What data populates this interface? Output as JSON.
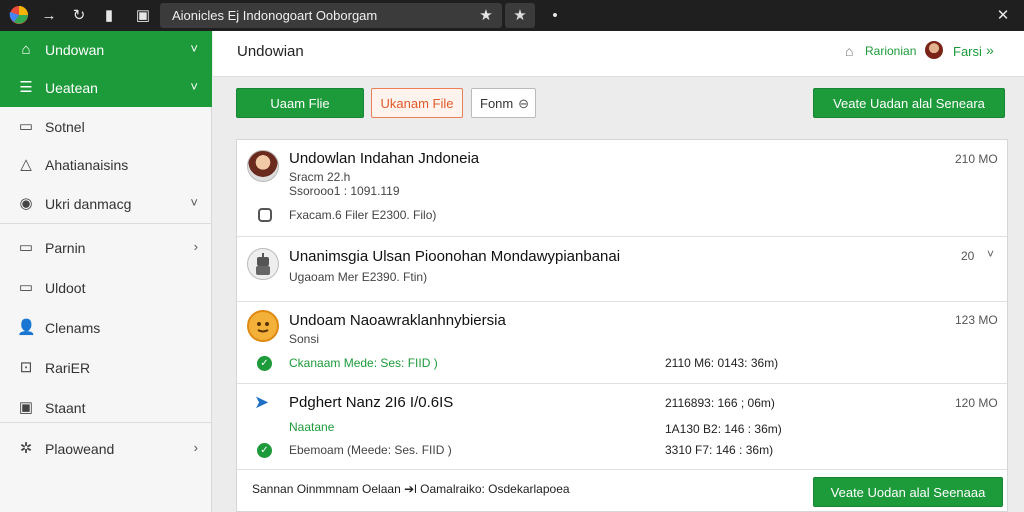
{
  "browser": {
    "url": "Aionicles Ej Indonogoart Ooborgam",
    "star": "★",
    "menu_dot": "•",
    "close": "✕"
  },
  "sidebar": {
    "items": [
      {
        "label": "Undowan",
        "icon": "home-icon",
        "glyph": "⌂",
        "chevron": "˅",
        "active": true
      },
      {
        "label": "Ueatean",
        "icon": "list-icon",
        "glyph": "☰",
        "chevron": "˅",
        "active": true
      },
      {
        "label": "Sotnel",
        "icon": "inbox-icon",
        "glyph": "▭",
        "chevron": ""
      },
      {
        "label": "Ahatianaisins",
        "icon": "bell-icon",
        "glyph": "△",
        "chevron": ""
      },
      {
        "label": "Ukri danmacg",
        "icon": "eye-icon",
        "glyph": "◉",
        "chevron": "˅"
      },
      {
        "label": "Parnin",
        "icon": "folder-icon",
        "glyph": "▭",
        "chevron": "›"
      },
      {
        "label": "Uldoot",
        "icon": "document-icon",
        "glyph": "▭",
        "chevron": ""
      },
      {
        "label": "Clenams",
        "icon": "user-icon",
        "glyph": "👤",
        "chevron": ""
      },
      {
        "label": "RariER",
        "icon": "tag-icon",
        "glyph": "⊡",
        "chevron": ""
      },
      {
        "label": "Staant",
        "icon": "image-icon",
        "glyph": "▣",
        "chevron": ""
      },
      {
        "label": "Plaoweand",
        "icon": "gear-icon",
        "glyph": "✲",
        "chevron": "›"
      }
    ]
  },
  "header": {
    "title": "Undowian",
    "link": "Rarionian",
    "user": "Farsi",
    "arrow": "»"
  },
  "toolbar": {
    "upload": "Uaam Flie",
    "upload_alt": "Ukanam File",
    "form": "Fonm",
    "form_icon": "⊖",
    "primary": "Veate Uadan alal Seneara"
  },
  "rows": [
    {
      "title": "Undowlan Indahan Jndoneia",
      "sub1": "Sracm 22.h",
      "sub2": "Ssorooo1 : 1091.119",
      "detail": "Fxacam.6 Filer E2300. Filo)",
      "size": "210 MO"
    },
    {
      "title": "Unanimsgia Ulsan Pioonohan Mondawypianbanai",
      "detail": "Ugaoam Mer E2390. Ftin)",
      "size": "20",
      "chevron": "˅"
    },
    {
      "title": "Undoam Naoawraklanhnybiersia",
      "sub1": "Sonsi",
      "status": "Ckanaam Mede: Ses: FIID )",
      "meta": "2110 M6: 0143: 36m)",
      "size": "123 MO"
    },
    {
      "title": "Pdghert Nanz 2I6 I/0.6IS",
      "sub1": "Naatane",
      "status": "Ebemoam (Meede: Ses. FIID )",
      "meta1": "2116893: 166 ; 06m)",
      "meta2": "1A130 B2: 146 : 36m)",
      "meta3": "3310 F7: 146 : 36m)",
      "size": "120 MO"
    }
  ],
  "footer": {
    "text": "Sannan Oinmmnam Oelaan ➔l Oamalraiko: Osdekarlapoea",
    "button": "Veate Uodan alal Seenaaa"
  }
}
